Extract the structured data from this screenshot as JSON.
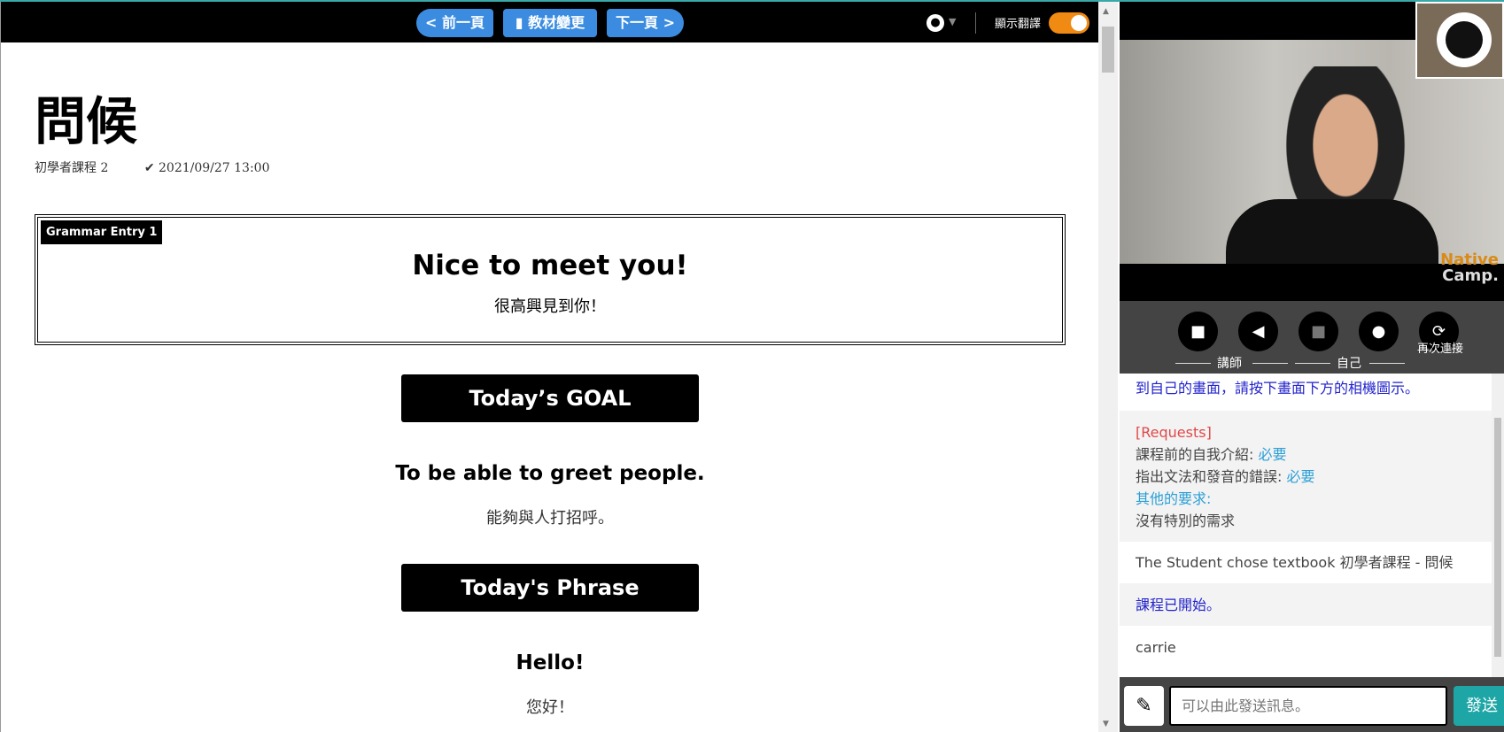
{
  "toolbar": {
    "prev": "< 前一頁",
    "change": "教材變更",
    "next": "下一頁 >",
    "translate_label": "顯示翻譯",
    "translate_on": true,
    "accent": "#3b8ce0",
    "toggle_color": "#f08a12"
  },
  "lesson": {
    "title": "問候",
    "course": "初學者課程 2",
    "date": "2021/09/27 13:00",
    "grammar_label": "Grammar Entry 1",
    "grammar_en": "Nice to meet you!",
    "grammar_zh": "很高興見到你！",
    "goal_header": "Today’s GOAL",
    "goal_en": "To be able to greet people.",
    "goal_zh": "能夠與人打招呼。",
    "phrase_header": "Today's Phrase",
    "phrase_en": "Hello!",
    "phrase_zh": "您好！"
  },
  "video": {
    "logo_line1": "Native",
    "logo_line2": "Camp."
  },
  "controls": {
    "tutor_label": "講師",
    "self_label": "自己",
    "reconnect_label": "再次連接"
  },
  "chat": {
    "messages": [
      {
        "text": "到自己的畫面，請按下畫面下方的相機圖示。"
      },
      {
        "requests_title": "[Requests]",
        "line1_label": "課程前的自我介紹: ",
        "line1_value": "必要",
        "line2_label": "指出文法和發音的錯誤: ",
        "line2_value": "必要",
        "line3_label": "其他的要求:",
        "line4": "沒有特別的需求"
      },
      {
        "text": "The Student chose textbook 初學者課程 - 問候"
      },
      {
        "text": "課程已開始。"
      },
      {
        "text": "carrie"
      }
    ],
    "input_placeholder": "可以由此發送訊息。",
    "send": "發送"
  }
}
